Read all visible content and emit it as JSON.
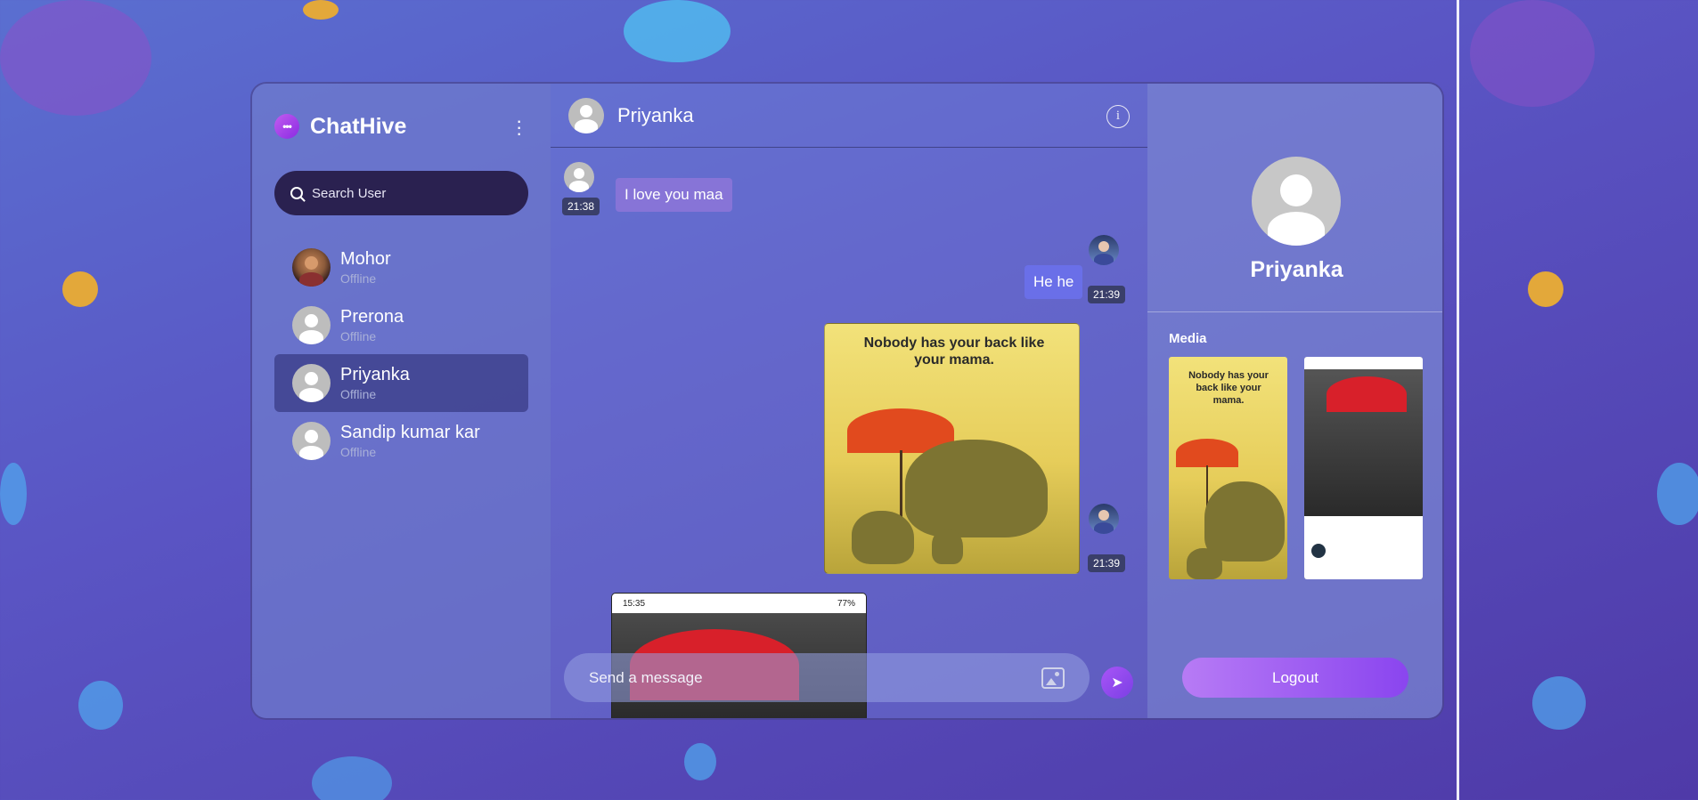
{
  "app": {
    "name": "ChatHive",
    "logo_glyph": "•••"
  },
  "search": {
    "placeholder": "Search User"
  },
  "users": [
    {
      "name": "Mohor",
      "status": "Offline",
      "has_photo": true
    },
    {
      "name": "Prerona",
      "status": "Offline"
    },
    {
      "name": "Priyanka",
      "status": "Offline",
      "active": true
    },
    {
      "name": "Sandip kumar kar",
      "status": "Offline"
    }
  ],
  "chat": {
    "contact_name": "Priyanka",
    "info_glyph": "i",
    "messages": [
      {
        "text": "I love you maa",
        "time": "21:38",
        "from": "them"
      },
      {
        "text": "He he",
        "time": "21:39",
        "from": "me"
      },
      {
        "image": "elephant-poster",
        "caption": "Nobody has your back like your mama.",
        "time": "21:39",
        "from": "me"
      },
      {
        "image": "phone-screenshot",
        "status_time": "15:35",
        "battery": "77%",
        "from": "them"
      }
    ],
    "composer_placeholder": "Send a message",
    "send_glyph": "➤"
  },
  "profile": {
    "name": "Priyanka",
    "media_label": "Media",
    "thumb_caption": "Nobody has your back like your mama.",
    "logout_label": "Logout"
  },
  "colors": {
    "accent": "#8a45ef",
    "search_bg": "#2a2150"
  }
}
